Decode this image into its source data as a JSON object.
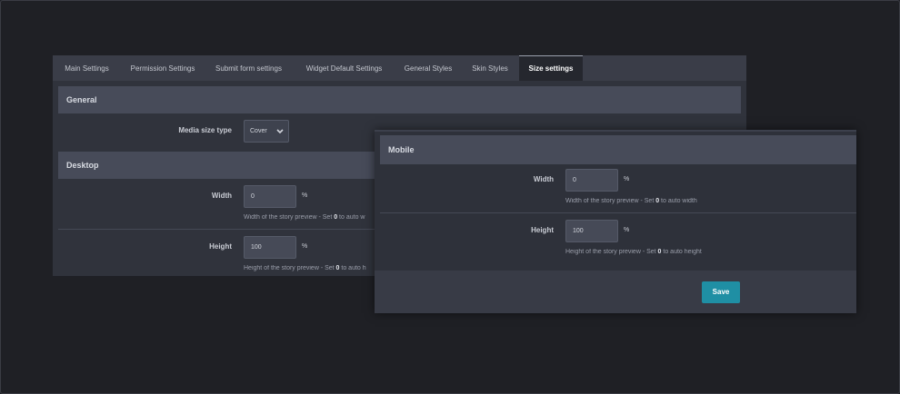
{
  "tabs": [
    {
      "label": "Main Settings",
      "active": false
    },
    {
      "label": "Permission Settings",
      "active": false
    },
    {
      "label": "Submit form settings",
      "active": false
    },
    {
      "label": "Widget Default Settings",
      "active": false
    },
    {
      "label": "General Styles",
      "active": false
    },
    {
      "label": "Skin Styles",
      "active": false
    },
    {
      "label": "Size settings",
      "active": true
    }
  ],
  "general": {
    "title": "General",
    "media_size_label": "Media size type",
    "media_size_value": "Cover",
    "chevron_icon": "chevron-down-icon"
  },
  "desktop": {
    "title": "Desktop",
    "width_label": "Width",
    "width_value": "0",
    "width_unit": "%",
    "width_help_prefix": "Width of the story preview - Set ",
    "width_help_bold": "0",
    "width_help_suffix": " to auto w",
    "height_label": "Height",
    "height_value": "100",
    "height_unit": "%",
    "height_help_prefix": "Height of the story preview - Set ",
    "height_help_bold": "0",
    "height_help_suffix": " to auto h"
  },
  "mobile": {
    "title": "Mobile",
    "width_label": "Width",
    "width_value": "0",
    "width_unit": "%",
    "width_help_prefix": "Width of the story preview - Set ",
    "width_help_bold": "0",
    "width_help_suffix": " to auto width",
    "height_label": "Height",
    "height_value": "100",
    "height_unit": "%",
    "height_help_prefix": "Height of the story preview - Set ",
    "height_help_bold": "0",
    "height_help_suffix": " to auto height"
  },
  "save_label": "Save",
  "colors": {
    "background": "#1f2025",
    "panel": "#30333c",
    "section_header": "#474b59",
    "accent_button": "#1f8fa4"
  }
}
